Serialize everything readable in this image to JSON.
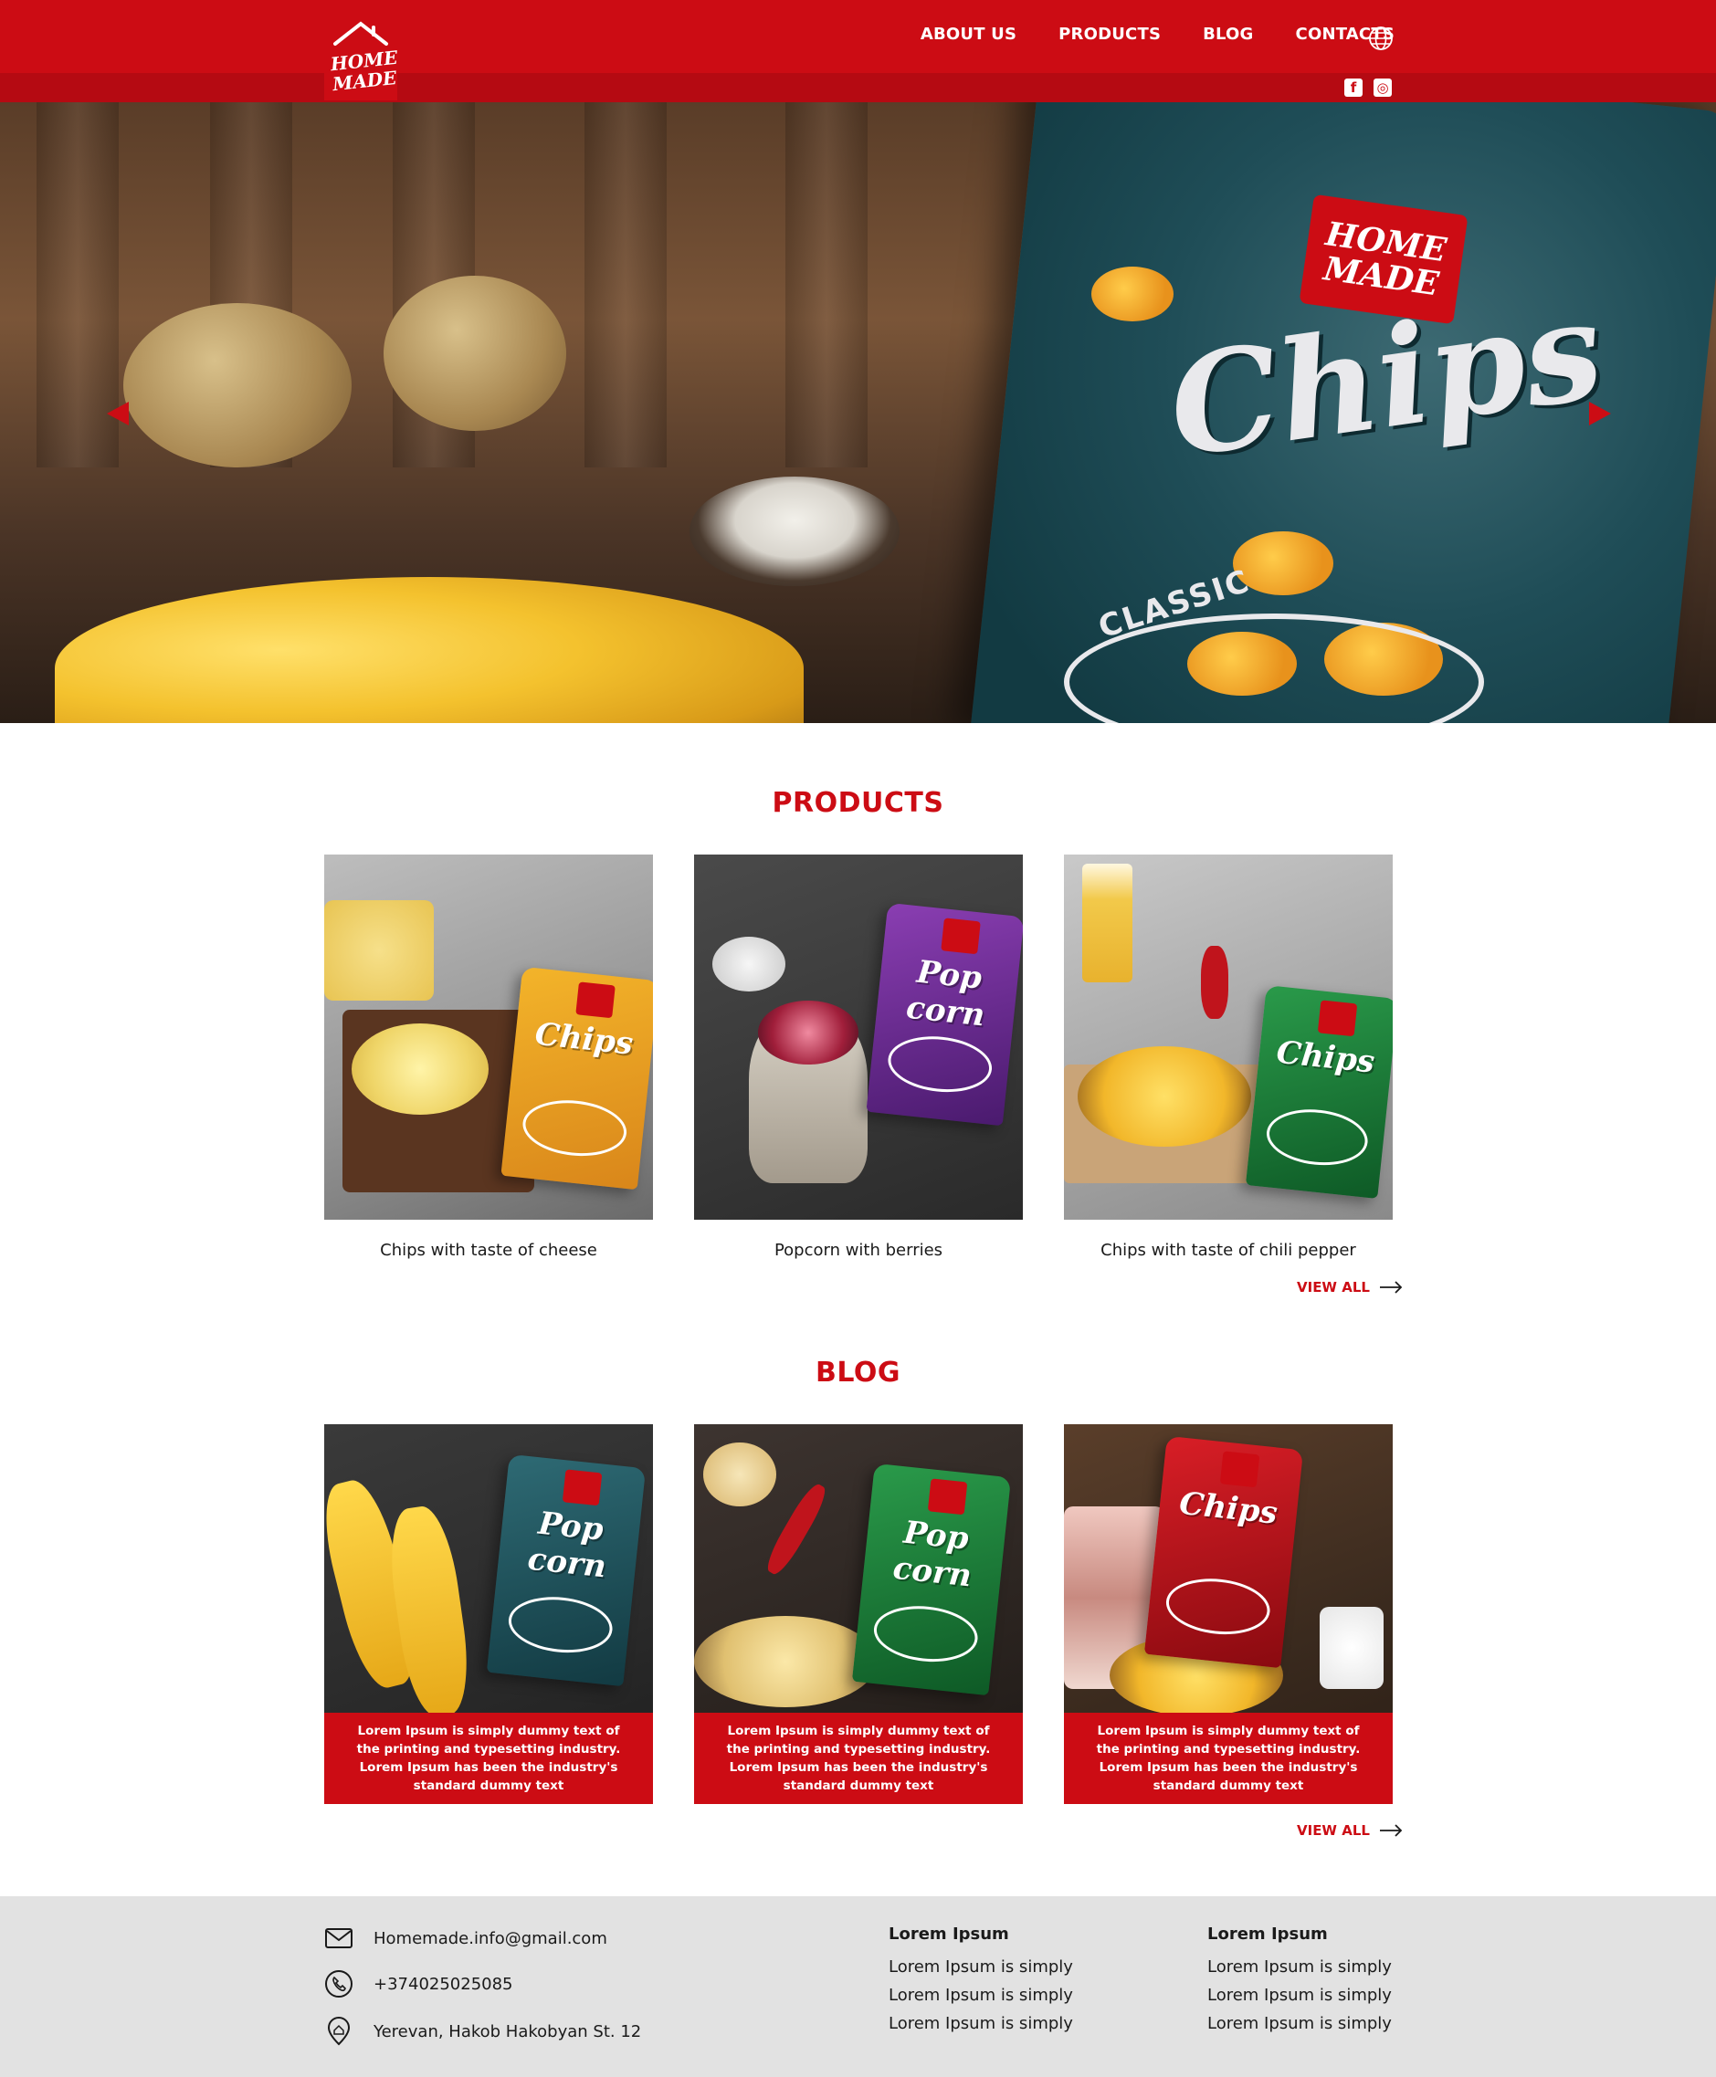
{
  "header": {
    "logo_text": "HOME MADE",
    "nav": [
      "ABOUT US",
      "PRODUCTS",
      "BLOG",
      "CONTACTS"
    ],
    "globe_icon": "globe-icon",
    "socials": [
      {
        "name": "facebook-icon",
        "glyph": "f"
      },
      {
        "name": "instagram-icon",
        "glyph": "◎"
      }
    ]
  },
  "hero": {
    "bag_logo": "HOME MADE",
    "bag_title": "Chips",
    "bag_subtitle": "CLASSIC"
  },
  "products": {
    "title": "PRODUCTS",
    "items": [
      {
        "caption": "Chips with taste of cheese",
        "pack_name": "Chips",
        "pack_color": "#e9a21a"
      },
      {
        "caption": "Popcorn with berries",
        "pack_name": "Pop corn",
        "pack_color": "#6a2c8e"
      },
      {
        "caption": "Chips with taste of chili pepper",
        "pack_name": "Chips",
        "pack_color": "#1f7a3a"
      }
    ],
    "view_all": "VIEW ALL"
  },
  "blog": {
    "title": "BLOG",
    "items": [
      {
        "text": "Lorem Ipsum is simply dummy text of the printing and typesetting industry. Lorem Ipsum has been the industry's standard dummy text",
        "pack_name": "Pop corn",
        "pack_color": "#1f4d57"
      },
      {
        "text": "Lorem Ipsum is simply dummy text of the printing and typesetting industry. Lorem Ipsum has been the industry's standard dummy text",
        "pack_name": "Pop corn",
        "pack_color": "#1f7a3a"
      },
      {
        "text": "Lorem Ipsum is simply dummy text of the printing and typesetting industry. Lorem Ipsum has been the industry's standard dummy text",
        "pack_name": "Chips",
        "pack_color": "#b0141c"
      }
    ],
    "view_all": "VIEW ALL"
  },
  "footer": {
    "email": "Homemade.info@gmail.com",
    "phone": "+374025025085",
    "address": "Yerevan, Hakob Hakobyan St. 12",
    "col1": {
      "title": "Lorem Ipsum",
      "links": [
        "Lorem Ipsum is simply",
        "Lorem Ipsum is simply",
        "Lorem Ipsum is simply"
      ]
    },
    "col2": {
      "title": "Lorem Ipsum",
      "links": [
        "Lorem Ipsum is simply",
        "Lorem Ipsum is simply",
        "Lorem Ipsum is simply"
      ]
    }
  },
  "colors": {
    "brand": "#cc0c14",
    "footer_bg": "#e2e2e2"
  }
}
